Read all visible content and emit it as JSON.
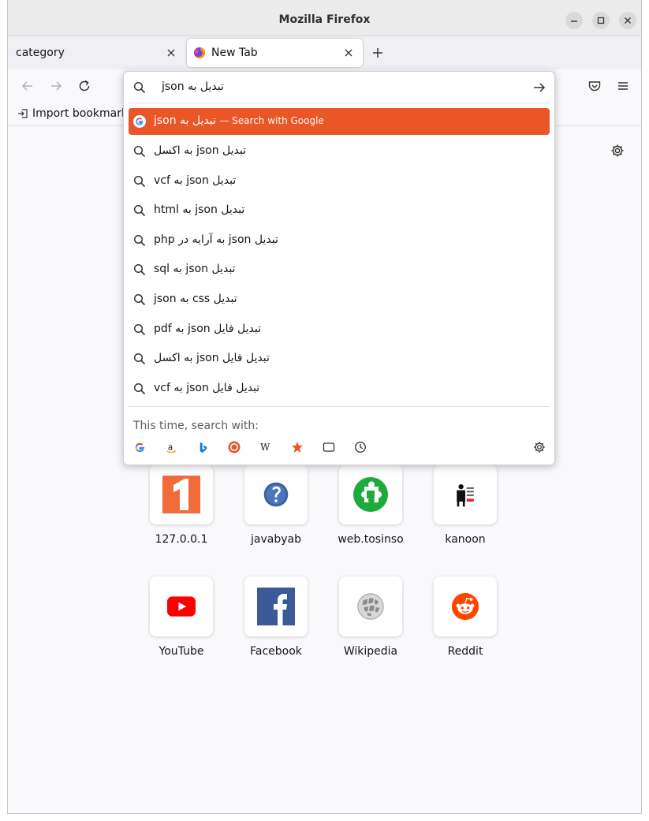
{
  "window": {
    "title": "Mozilla Firefox"
  },
  "tabs": [
    {
      "label": "category",
      "active": false
    },
    {
      "label": "New Tab",
      "active": true
    }
  ],
  "bookmarks_bar": {
    "import_label": "Import bookmark"
  },
  "urlbar": {
    "query": "تبدیل به json",
    "heuristic": {
      "text": "تبدیل به json",
      "hint": "— Search with Google"
    },
    "suggestions": [
      "تبدیل json به اکسل",
      "تبدیل json به vcf",
      "تبدیل json به html",
      "تبدیل json به آرایه در php",
      "تبدیل json به sql",
      "تبدیل css به json",
      "تبدیل فایل json به pdf",
      "تبدیل فایل json به اکسل",
      "تبدیل فایل json به vcf"
    ],
    "oneoff_label": "This time, search with:",
    "engines": [
      "google-icon",
      "amazon-icon",
      "bing-icon",
      "duckduckgo-icon",
      "wikipedia-icon",
      "bookmarks-star-icon",
      "tabs-icon",
      "history-icon"
    ]
  },
  "top_sites": [
    {
      "label": "127.0.0.1"
    },
    {
      "label": "javabyab"
    },
    {
      "label": "web.tosinso"
    },
    {
      "label": "kanoon"
    },
    {
      "label": "YouTube"
    },
    {
      "label": "Facebook"
    },
    {
      "label": "Wikipedia"
    },
    {
      "label": "Reddit"
    }
  ],
  "colors": {
    "accent": "#ea5628",
    "page_bg": "#f9f9fb"
  }
}
